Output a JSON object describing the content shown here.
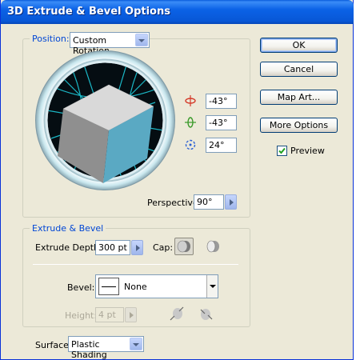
{
  "window": {
    "title": "3D Extrude & Bevel Options"
  },
  "position": {
    "legend": "Position:",
    "preset": "Custom Rotation",
    "x_rotation": "-43°",
    "y_rotation": "-43°",
    "z_rotation": "24°",
    "perspective_label": "Perspective:",
    "perspective_value": "90°"
  },
  "buttons": {
    "ok": "OK",
    "cancel": "Cancel",
    "map_art": "Map Art...",
    "more_options": "More Options"
  },
  "preview": {
    "label": "Preview",
    "checked": true
  },
  "extrude": {
    "legend": "Extrude & Bevel",
    "depth_label": "Extrude Depth:",
    "depth_value": "300 pt",
    "cap_label": "Cap:",
    "bevel_label": "Bevel:",
    "bevel_value": "None",
    "height_label": "Height:",
    "height_value": "4 pt"
  },
  "surface": {
    "label": "Surface:",
    "value": "Plastic Shading"
  },
  "colors": {
    "accent": "#0046d5",
    "cube_light": "#d8d8d8",
    "cube_dark": "#8d8d8d",
    "cube_blue": "#5aa9c3",
    "track_teal": "#1bb8c6"
  }
}
